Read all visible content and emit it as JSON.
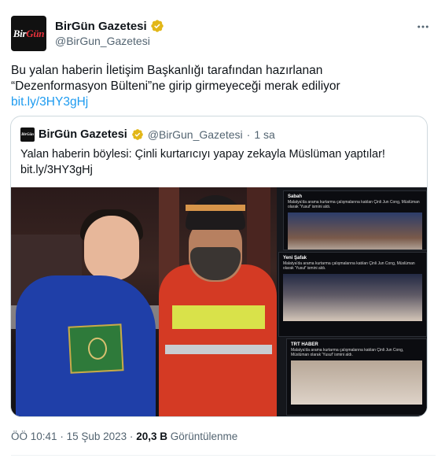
{
  "author": {
    "display_name": "BirGün Gazetesi",
    "handle": "@BirGun_Gazetesi",
    "avatar_text_a": "Bir",
    "avatar_text_b": "Gün",
    "verified_color": "#e2b719"
  },
  "tweet": {
    "text_line1": "Bu yalan haberin İletişim Başkanlığı tarafından hazırlanan",
    "text_line2": "“Dezenformasyon Bülteni”ne girip girmeyeceği merak ediliyor",
    "link": "bit.ly/3HY3gHj",
    "link_color": "#1d9bf0"
  },
  "quote": {
    "display_name": "BirGün Gazetesi",
    "handle": "@BirGun_Gazetesi",
    "separator": "·",
    "time": "1 sa",
    "text": "Yalan haberin böylesi: Çinli kurtarıcıyı yapay zekayla Müslüman yaptılar!",
    "link": "bit.ly/3HY3gHj",
    "collage": [
      {
        "source": "Sabah",
        "text": "Malatya'da arama kurtarma çalışmalarına katılan Çinli Jun Cong, Müslüman olarak 'Yusuf' ismini aldı."
      },
      {
        "source": "Yeni Şafak",
        "text": "Malatya'da arama kurtarma çalışmalarına katılan Çinli Jun Cong, Müslüman olarak 'Yusuf' ismini aldı."
      },
      {
        "source": "TRT HABER",
        "text": "Malatya'da arama kurtarma çalışmalarına katılan Çinli Jun Cong, Müslüman olarak 'Yusuf' ismini aldı."
      }
    ]
  },
  "meta": {
    "time": "ÖÖ 10:41",
    "separator": "·",
    "date": "15 Şub 2023",
    "views_count": "20,3 B",
    "views_label": "Görüntülenme"
  }
}
